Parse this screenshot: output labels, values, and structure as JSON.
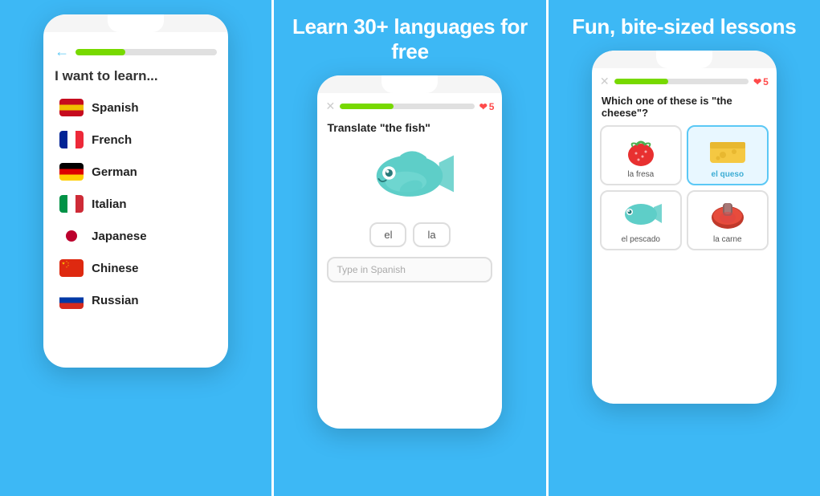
{
  "panels": [
    {
      "id": "language-list",
      "title": null,
      "learn_prompt": "I want to learn...",
      "languages": [
        {
          "name": "Spanish",
          "flag": "es"
        },
        {
          "name": "French",
          "flag": "fr"
        },
        {
          "name": "German",
          "flag": "de"
        },
        {
          "name": "Italian",
          "flag": "it"
        },
        {
          "name": "Japanese",
          "flag": "ja"
        },
        {
          "name": "Chinese",
          "flag": "cn"
        },
        {
          "name": "Russian",
          "flag": "ru"
        }
      ]
    },
    {
      "id": "translate",
      "title": "Learn 30+ languages for free",
      "hearts_count": "5",
      "prompt": "Translate \"the fish\"",
      "word_options": [
        "el",
        "la"
      ],
      "input_placeholder": "Type in Spanish"
    },
    {
      "id": "which-cheese",
      "title": "Fun, bite-sized lessons",
      "hearts_count": "5",
      "prompt": "Which one of these is \"the cheese\"?",
      "items": [
        {
          "label": "la fresa",
          "selected": false,
          "type": "strawberry"
        },
        {
          "label": "el queso",
          "selected": true,
          "type": "cheese"
        },
        {
          "label": "el pescado",
          "selected": false,
          "type": "fish"
        },
        {
          "label": "la carne",
          "selected": false,
          "type": "meat"
        }
      ]
    }
  ]
}
